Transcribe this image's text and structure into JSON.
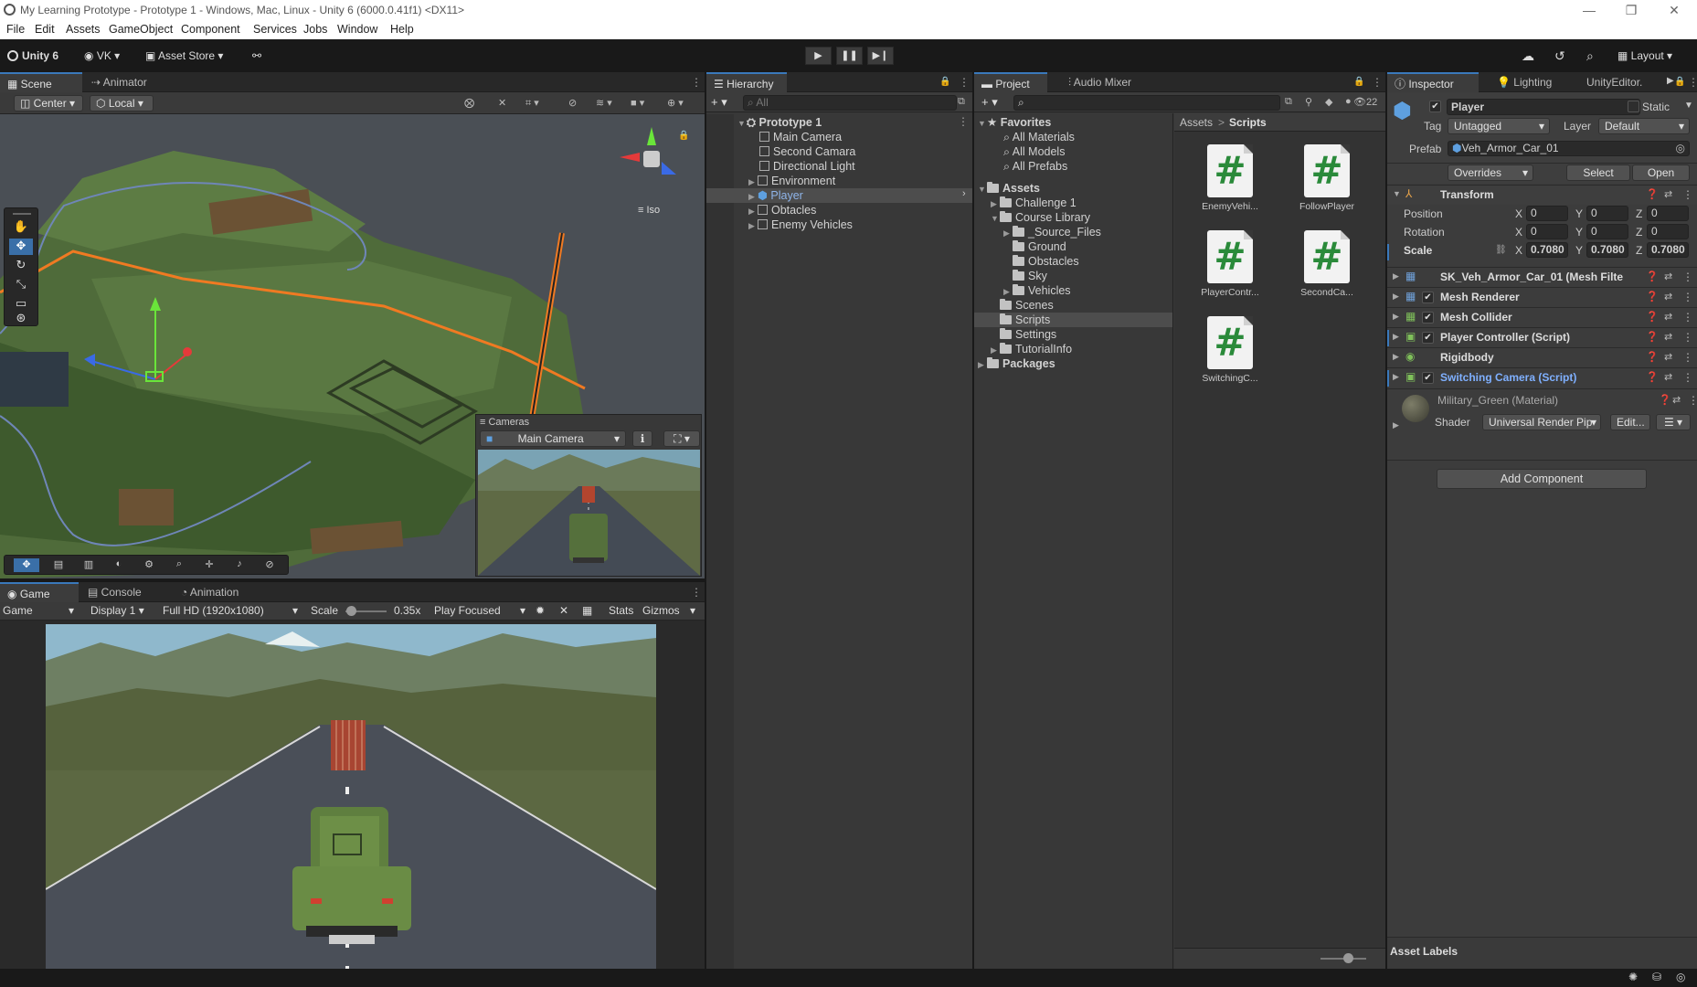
{
  "window": {
    "title": "My Learning Prototype - Prototype 1 - Windows, Mac, Linux - Unity 6 (6000.0.41f1) <DX11>",
    "minimize": "—",
    "restore": "❐",
    "close": "✕"
  },
  "menu": [
    "File",
    "Edit",
    "Assets",
    "GameObject",
    "Component",
    "Services",
    "Jobs",
    "Window",
    "Help"
  ],
  "toolbar": {
    "unity_label": "Unity 6",
    "account": "VK",
    "asset_store": "Asset Store",
    "layout": "Layout"
  },
  "scene": {
    "tabs": [
      "Scene",
      "Animator"
    ],
    "pivot": "Center",
    "space": "Local",
    "gizmo_label": "Iso",
    "overlay_title": "Cameras",
    "overlay_camera": "Main Camera"
  },
  "game": {
    "tabs": [
      "Game",
      "Console",
      "Animation"
    ],
    "mode": "Game",
    "display": "Display 1",
    "resolution": "Full HD (1920x1080)",
    "scale_label": "Scale",
    "scale_value": "0.35x",
    "play_mode": "Play Focused",
    "stats": "Stats",
    "gizmos": "Gizmos"
  },
  "hierarchy": {
    "tab": "Hierarchy",
    "search_placeholder": "All",
    "scene_name": "Prototype 1",
    "items": [
      "Main Camera",
      "Second Camara",
      "Directional Light",
      "Environment",
      "Player",
      "Obtacles",
      "Enemy Vehicles"
    ]
  },
  "project": {
    "tabs": [
      "Project",
      "Audio Mixer"
    ],
    "count": "22",
    "favorites_label": "Favorites",
    "favorites": [
      "All Materials",
      "All Models",
      "All Prefabs"
    ],
    "assets_label": "Assets",
    "tree": [
      "Challenge 1",
      "Course Library",
      "_Source_Files",
      "Ground",
      "Obstacles",
      "Sky",
      "Vehicles",
      "Scenes",
      "Scripts",
      "Settings",
      "TutorialInfo"
    ],
    "packages_label": "Packages",
    "breadcrumb_root": "Assets",
    "breadcrumb_sep": ">",
    "breadcrumb_current": "Scripts",
    "files": [
      "EnemyVehi...",
      "FollowPlayer",
      "PlayerContr...",
      "SecondCa...",
      "SwitchingC..."
    ]
  },
  "inspector": {
    "tabs": [
      "Inspector",
      "Lighting",
      "UnityEditor."
    ],
    "object_name": "Player",
    "static_label": "Static",
    "tag_label": "Tag",
    "tag_value": "Untagged",
    "layer_label": "Layer",
    "layer_value": "Default",
    "prefab_label": "Prefab",
    "prefab_value": "Veh_Armor_Car_01",
    "overrides": "Overrides",
    "select": "Select",
    "open": "Open",
    "transform_title": "Transform",
    "position_label": "Position",
    "rotation_label": "Rotation",
    "scale_label": "Scale",
    "position": {
      "x": "0",
      "y": "0",
      "z": "0"
    },
    "rotation": {
      "x": "0",
      "y": "0",
      "z": "0"
    },
    "scale": {
      "x": "0.7080",
      "y": "0.7080",
      "z": "0.7080"
    },
    "axis": {
      "x": "X",
      "y": "Y",
      "z": "Z"
    },
    "components": [
      "SK_Veh_Armor_Car_01 (Mesh Filte",
      "Mesh Renderer",
      "Mesh Collider",
      "Player Controller (Script)",
      "Rigidbody",
      "Switching Camera (Script)"
    ],
    "material_name": "Military_Green (Material)",
    "shader_label": "Shader",
    "shader_value": "Universal Render Pip",
    "edit_label": "Edit...",
    "add_component": "Add Component",
    "asset_labels": "Asset Labels"
  },
  "colors": {
    "accent": "#3a79bb",
    "script_link": "#7fb0ff",
    "selection": "#4d4d4d",
    "grass": "#5b6f3c",
    "orange": "#f07a22"
  }
}
